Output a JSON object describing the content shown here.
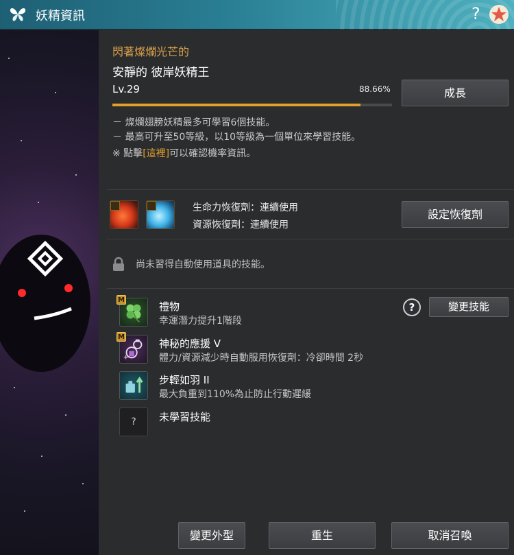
{
  "window": {
    "title": "妖精資訊",
    "help_glyph": "?",
    "accent": "#2a7f94"
  },
  "fairy": {
    "name_line1": "閃著燦爛光芒的",
    "name_line2": "安靜的 彼岸妖精王",
    "level": "Lv.29",
    "exp_percent_text": "88.66%",
    "exp_fraction": 0.8866
  },
  "buttons": {
    "grow": "成長",
    "set_potion": "設定恢復劑",
    "change_skill": "變更技能",
    "change_look": "變更外型",
    "rebirth": "重生",
    "unsummon": "取消召喚"
  },
  "info": {
    "line1": "－ 燦爛翅膀妖精最多可學習6個技能。",
    "line2": "－ 最高可升至50等級，以10等級為一個單位來學習技能。",
    "line3_prefix": "※ 點擊",
    "line3_link": "[這裡]",
    "line3_suffix": "可以確認機率資訊。"
  },
  "potions": {
    "hp": "生命力恢復劑：連續使用",
    "mp": "資源恢復劑：連續使用",
    "hp_icon": "red-potion-icon",
    "mp_icon": "blue-potion-icon"
  },
  "auto_item": {
    "text": "尚未習得自動使用道具的技能。",
    "icon": "lock-icon"
  },
  "skills": [
    {
      "name": "禮物",
      "desc": "幸運潛力提升1階段",
      "badge": "M",
      "icon": "clover-icon"
    },
    {
      "name": "神秘的應援 V",
      "desc": "體力/資源減少時自動服用恢復劑：冷卻時間 2秒",
      "badge": "M",
      "icon": "potion-cycle-icon"
    },
    {
      "name": "步輕如羽 II",
      "desc": "最大負重到110%為止防止行動遲緩",
      "badge": "",
      "icon": "weight-icon"
    },
    {
      "name": "未學習技能",
      "desc": "",
      "badge": "",
      "icon": "unknown-icon",
      "icon_glyph": "?"
    }
  ],
  "help_button_glyph": "?"
}
